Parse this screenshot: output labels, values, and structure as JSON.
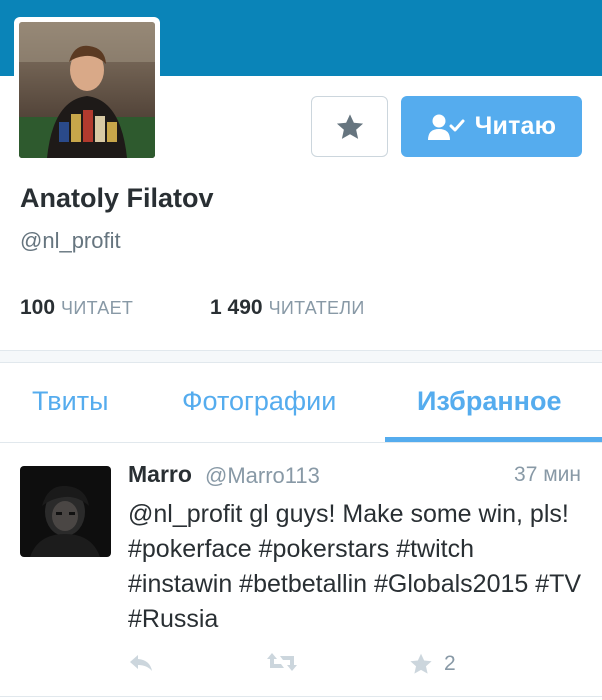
{
  "profile": {
    "name": "Anatoly Filatov",
    "handle": "@nl_profit",
    "follow_label": "Читаю",
    "following_count": "100",
    "following_label": "ЧИТАЕТ",
    "followers_count": "1 490",
    "followers_label": "ЧИТАТЕЛИ"
  },
  "tabs": [
    {
      "label": "Твиты",
      "active": false
    },
    {
      "label": "Фотографии",
      "active": false
    },
    {
      "label": "Избранное",
      "active": true
    }
  ],
  "tweet": {
    "author": "Marro",
    "handle": "@Marro113",
    "time": "37 мин",
    "text": "@nl_profit gl guys! Make some win, pls! #pokerface #pokerstars #twitch #instawin #betbetallin #Globals2015 #TV #Russia",
    "favorites": "2"
  },
  "colors": {
    "banner": "#0a84b8",
    "accent": "#55acee",
    "muted": "#8899a6"
  },
  "icons": [
    "star-icon",
    "follow-check-icon",
    "reply-icon",
    "retweet-icon",
    "favorite-icon"
  ]
}
